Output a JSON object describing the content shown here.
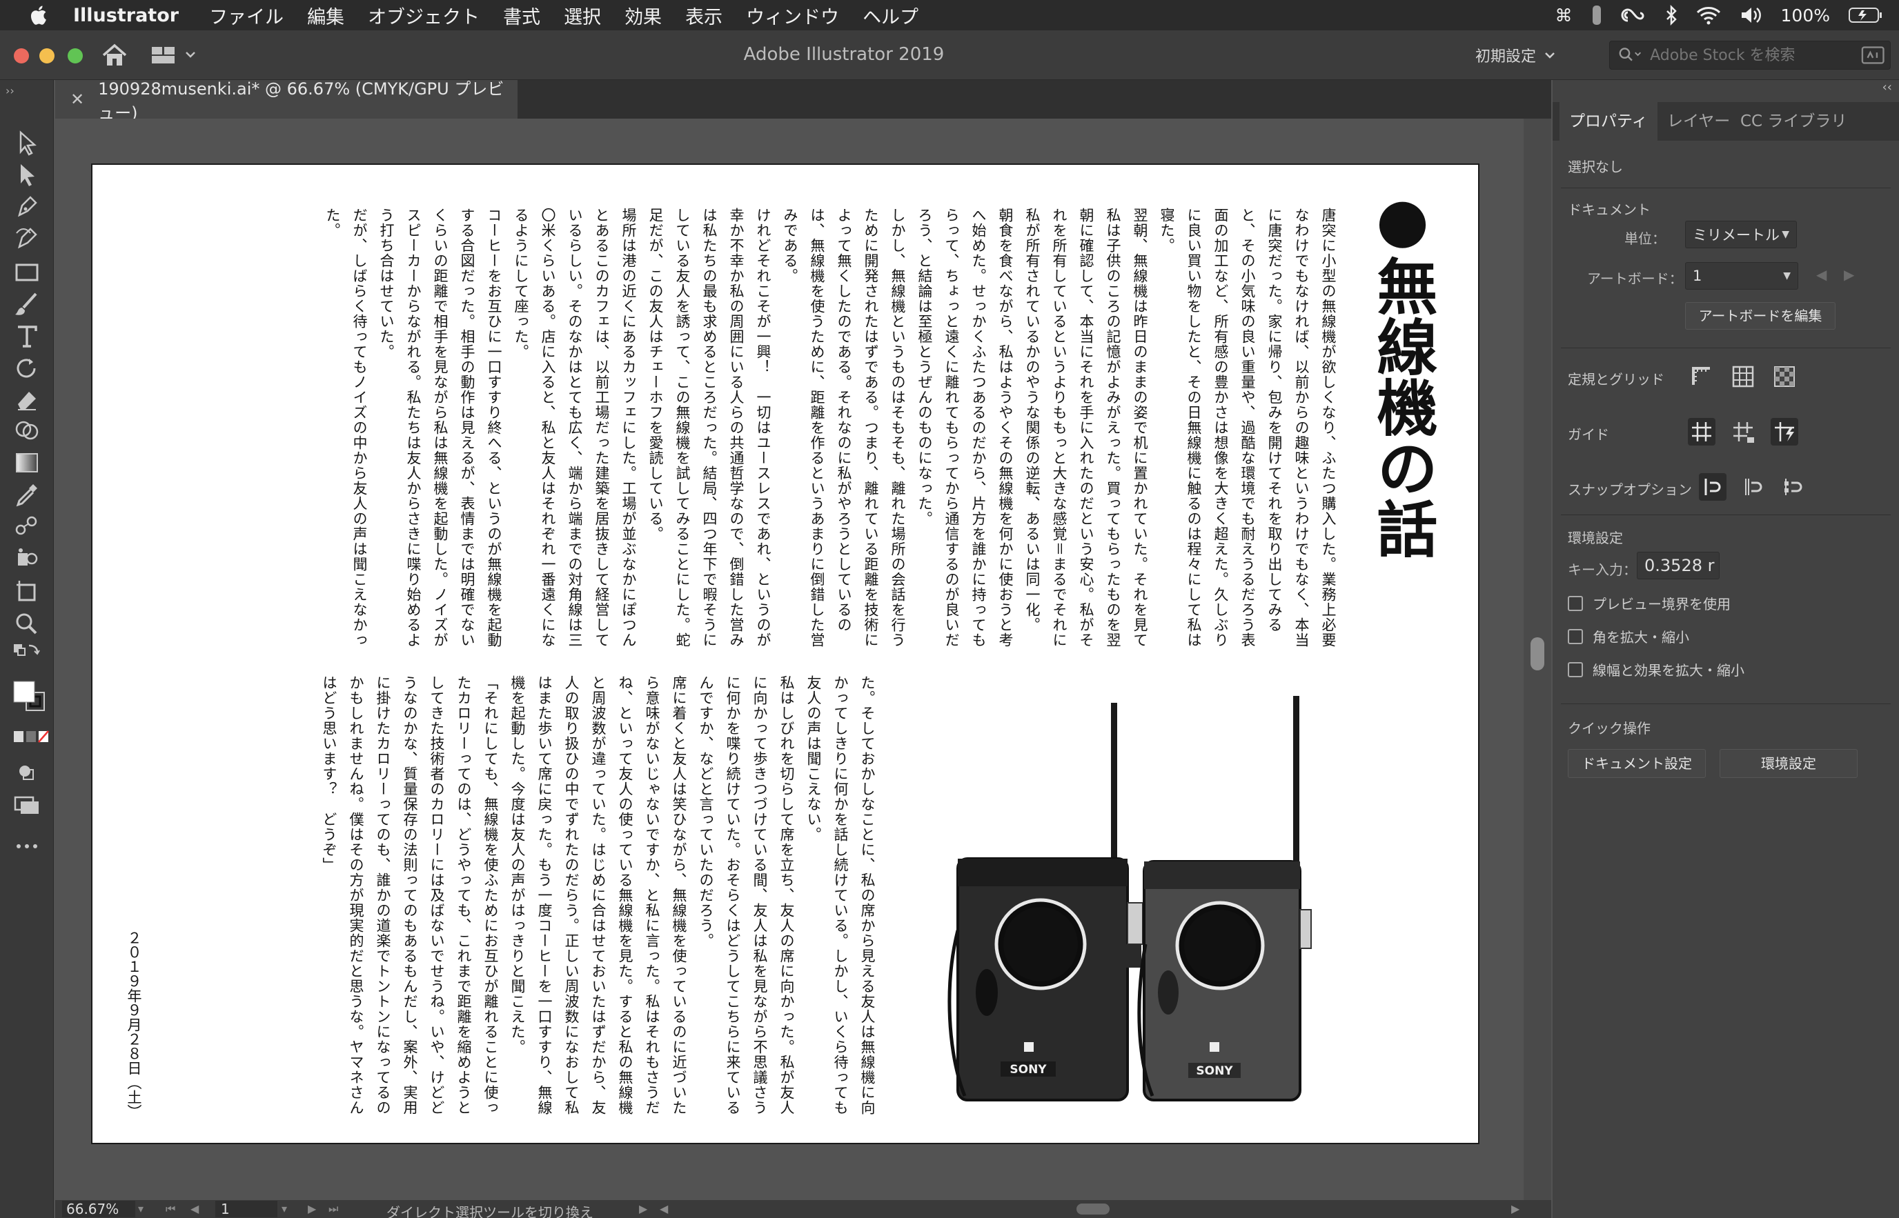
{
  "menubar": {
    "app_name": "Illustrator",
    "menus": [
      "ファイル",
      "編集",
      "オブジェクト",
      "書式",
      "選択",
      "効果",
      "表示",
      "ウィンドウ",
      "ヘルプ"
    ],
    "battery": "100%"
  },
  "titlebar": {
    "title": "Adobe Illustrator 2019",
    "workspace": "初期設定",
    "stock_search_placeholder": "Adobe Stock を検索"
  },
  "document_tab": {
    "title": "190928musenki.ai* @ 66.67% (CMYK/GPU プレビュー)"
  },
  "artboard": {
    "heading": "●無線機の話",
    "paragraphs_top": [
      "唐突に小型の無線機が欲しくなり、ふたつ購入した。業務上必要なわけでもなければ、以前からの趣味というわけでもなく、本当に唐突だった。家に帰り、包みを開けてそれを取り出してみると、その小気味の良い重量や、過酷な環境でも耐えうるだろう表面の加工など、所有感の豊かさは想像を大きく超えた。久しぶりに良い買い物をしたと、その日無線機に触るのは程々にして私は寝た。",
      "翌朝、無線機は昨日のままの姿で机に置かれていた。それを見て私は子供のころの記憶がよみがえった。買ってもらったものを翌朝に確認して、本当にそれを手に入れたのだという安心。私がそれを所有しているというよりももっと大きな感覚＝まるでそれに私が所有されているかのやうな関係の逆転、あるいは同一化。",
      "朝食を食べながら、私はようやくその無線機を何かに使おうと考へ始めた。せっかくふたつあるのだから、片方を誰かに持ってもらって、ちょっと遠くに離れてもらってから通信するのが良いだろう、と結論は至極とうぜんのものになった。",
      "しかし、無線機というものはそもそも、離れた場所の会話を行うために開発されたはずである。つまり、離れている距離を技術によって無くしたのである。それなのに私がやろうとしているのは、無線機を使うために、距離を作るというあまりに倒錯した営みである。",
      "けれどそれこそが一興！　一切はユースレスであれ、というのが幸か不幸か私の周囲にいる人らの共通哲学なので、倒錯した営みは私たちの最も求めるところだった。結局、四つ年下で暇そうにしている友人を誘って、この無線機を試してみることにした。蛇足だが、この友人はチェーホフを愛読している。",
      "場所は港の近くにあるカッフェにした。工場が並ぶなかにぽつんとあるこのカフェは、以前工場だった建築を居抜きして経営しているらしい。そのなかはとても広く、端から端までの対角線は三〇米くらいある。店に入ると、私と友人はそれぞれ一番遠くになるようにして座った。",
      "コーヒーをお互ひに一口すすり終へる、というのが無線機を起動する合図だった。相手の動作は見えるが、表情までは明確でないくらいの距離で相手を見ながら私は無線機を起動した。ノイズがスピーカーからながれる。私たちは友人からさきに喋り始めるよう打ち合はせていた。",
      "だが、しばらく待ってもノイズの中から友人の声は聞こえなかった。"
    ],
    "paragraphs_bottom": [
      "た。そしておかしなことに、私の席から見える友人は無線機に向かってしきりに何かを話し続けている。しかし、いくら待っても友人の声は聞こえない。",
      "私はしびれを切らして席を立ち、友人の席に向かった。私が友人に向かって歩きつづけている間、友人は私を見ながら不思議さうに何かを喋り続けていた。おそらくはどうしてこちらに来ているんですか、などと言っていたのだろう。",
      "席に着くと友人は笑ひながら、無線機を使っているのに近づいたら意味がないじゃないですか、と私に言った。私はそれもさうだね、といって友人の使っている無線機を見た。すると私の無線機と周波数が違っていた。はじめに合はせておいたはずだから、友人の取り扱ひの中でずれたのだらう。正しい周波数になおして私はまた歩いて席に戻った。もう一度コーヒーを一口すすり、無線機を起動した。今度は友人の声がはっきりと聞こえた。",
      "「それにしても、無線機を使ふためにお互ひが離れることに使ったカロリーってのは、どうやっても、これまで距離を縮めようとしてきた技術者のカロリーには及ばないでせうね。いや、けどどうなのかな、質量保存の法則ってのもあるもんだし、案外、実用に掛けたカロリーってのも、誰かの道楽でトントンになってるのかもしれませんね。僕はその方が現実的だと思うな。ヤマネさんはどう思います？　どうぞ」"
    ],
    "date": "２０１９年９月２８日（土）",
    "radio_brand": "SONY"
  },
  "status": {
    "zoom": "66.67%",
    "artboard_number": "1",
    "current_tool": "ダイレクト選択ツールを切り換え"
  },
  "panel": {
    "tabs": [
      "プロパティ",
      "レイヤー",
      "CC ライブラリ"
    ],
    "selection": "選択なし",
    "document_label": "ドキュメント",
    "units_label": "単位：",
    "units_value": "ミリメートル",
    "artboard_label": "アートボード：",
    "artboard_value": "1",
    "edit_artboards_button": "アートボードを編集",
    "rulers_label": "定規とグリッド",
    "guides_label": "ガイド",
    "snap_label": "スナップオプション",
    "preferences_label": "環境設定",
    "key_increment_label": "キー入力：",
    "key_increment_value": "0.3528 r",
    "checkboxes": [
      "プレビュー境界を使用",
      "角を拡大・縮小",
      "線幅と効果を拡大・縮小"
    ],
    "quick_actions_label": "クイック操作",
    "document_setup_button": "ドキュメント設定",
    "preferences_button": "環境設定"
  }
}
